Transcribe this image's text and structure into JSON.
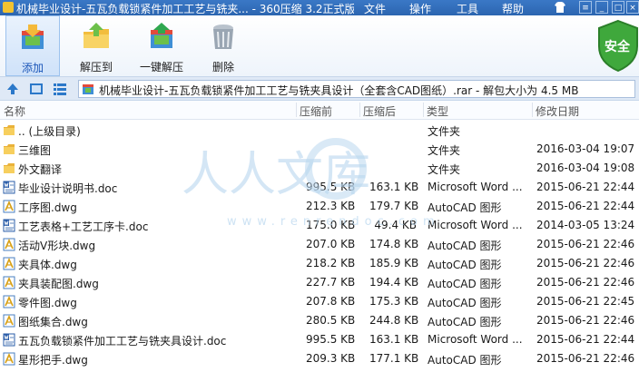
{
  "window": {
    "title": "机械毕业设计-五瓦负载锁紧件加工工艺与铣夹... - 360压缩 3.2正式版",
    "menu": [
      "文件",
      "操作",
      "工具",
      "帮助"
    ]
  },
  "toolbar": {
    "add": "添加",
    "extract_to": "解压到",
    "one_click_extract": "一键解压",
    "delete": "删除",
    "security_badge": "安全"
  },
  "address": {
    "path": "机械毕业设计-五瓦负载锁紧件加工工艺与铣夹具设计（全套含CAD图纸）.rar - 解包大小为 4.5 MB"
  },
  "columns": {
    "name": "名称",
    "compressed": "压缩前",
    "packed": "压缩后",
    "type": "类型",
    "modified": "修改日期"
  },
  "watermark": {
    "text": "人人文库",
    "url": "www.renrendoc.com"
  },
  "files": [
    {
      "name": ".. (上级目录)",
      "size": "",
      "packed": "",
      "type": "文件夹",
      "date": "",
      "icon": "folder"
    },
    {
      "name": "三维图",
      "size": "",
      "packed": "",
      "type": "文件夹",
      "date": "2016-03-04 19:07",
      "icon": "folder"
    },
    {
      "name": "外文翻译",
      "size": "",
      "packed": "",
      "type": "文件夹",
      "date": "2016-03-04 19:08",
      "icon": "folder"
    },
    {
      "name": "毕业设计说明书.doc",
      "size": "995.5 KB",
      "packed": "163.1 KB",
      "type": "Microsoft Word ...",
      "date": "2015-06-21 22:44",
      "icon": "word"
    },
    {
      "name": "工序图.dwg",
      "size": "212.3 KB",
      "packed": "179.7 KB",
      "type": "AutoCAD 图形",
      "date": "2015-06-21 22:44",
      "icon": "dwg"
    },
    {
      "name": "工艺表格+工艺工序卡.doc",
      "size": "175.0 KB",
      "packed": "49.4 KB",
      "type": "Microsoft Word ...",
      "date": "2014-03-05 13:24",
      "icon": "word"
    },
    {
      "name": "活动V形块.dwg",
      "size": "207.0 KB",
      "packed": "174.8 KB",
      "type": "AutoCAD 图形",
      "date": "2015-06-21 22:46",
      "icon": "dwg"
    },
    {
      "name": "夹具体.dwg",
      "size": "218.2 KB",
      "packed": "185.9 KB",
      "type": "AutoCAD 图形",
      "date": "2015-06-21 22:46",
      "icon": "dwg"
    },
    {
      "name": "夹具装配图.dwg",
      "size": "227.7 KB",
      "packed": "194.4 KB",
      "type": "AutoCAD 图形",
      "date": "2015-06-21 22:46",
      "icon": "dwg"
    },
    {
      "name": "零件图.dwg",
      "size": "207.8 KB",
      "packed": "175.3 KB",
      "type": "AutoCAD 图形",
      "date": "2015-06-21 22:45",
      "icon": "dwg"
    },
    {
      "name": "图纸集合.dwg",
      "size": "280.5 KB",
      "packed": "244.8 KB",
      "type": "AutoCAD 图形",
      "date": "2015-06-21 22:46",
      "icon": "dwg"
    },
    {
      "name": "五瓦负载锁紧件加工工艺与铣夹具设计.doc",
      "size": "995.5 KB",
      "packed": "163.1 KB",
      "type": "Microsoft Word ...",
      "date": "2015-06-21 22:44",
      "icon": "word"
    },
    {
      "name": "星形把手.dwg",
      "size": "209.3 KB",
      "packed": "177.1 KB",
      "type": "AutoCAD 图形",
      "date": "2015-06-21 22:46",
      "icon": "dwg"
    }
  ]
}
